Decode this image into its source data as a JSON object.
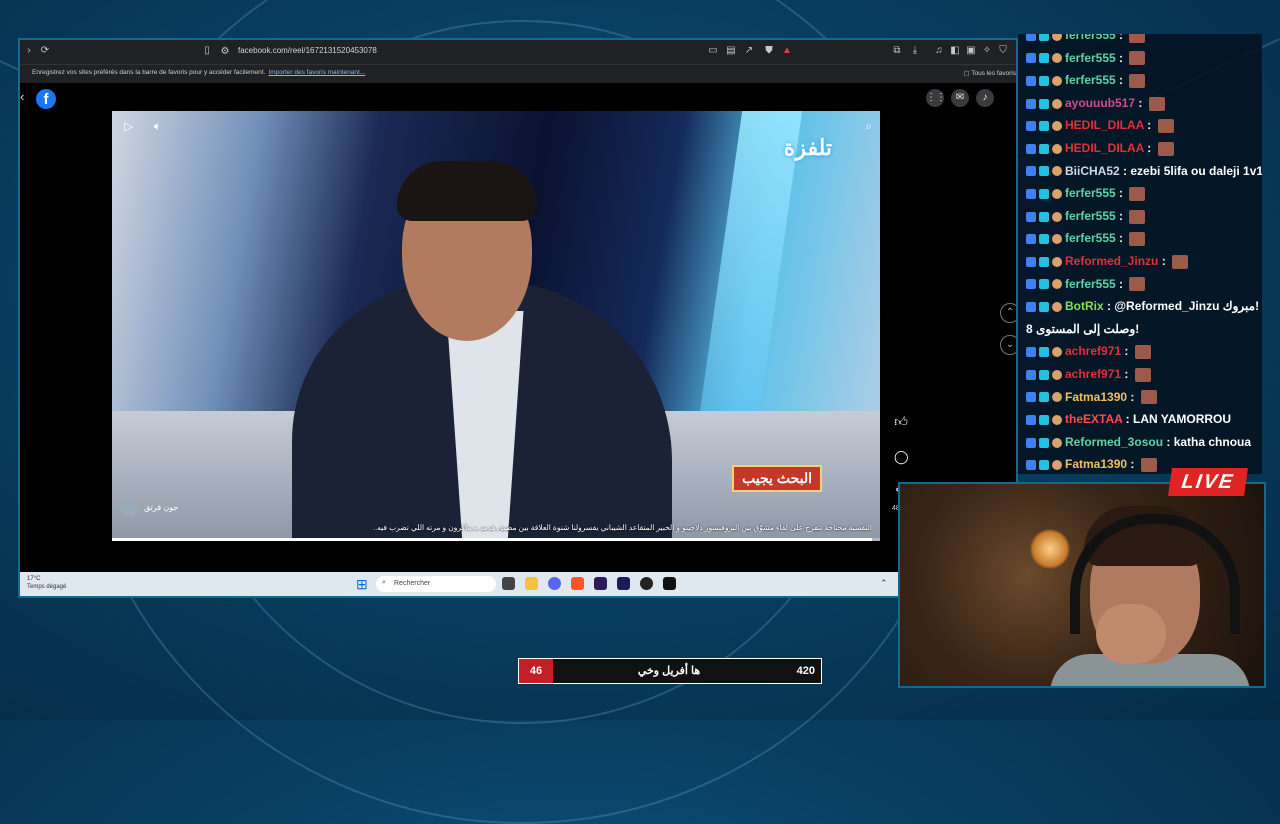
{
  "browser": {
    "url": "facebook.com/reel/1672131520453078",
    "bookmark_hint": "Enregistrez vos sites préférés dans la barre de favoris pour y accéder facilement.",
    "bookmark_link": "Importer des favoris maintenant...",
    "all_favorites": "Tous les favoris"
  },
  "facebook": {
    "logo": "f",
    "video": {
      "channel_logo": "تلفزة",
      "program_badge": "البحث يجيب",
      "page_name": "جون فرتق",
      "caption": "النفسية محتاجة تتفرج على لقاء مشوّق بين البروفيسور دلاجينو و الخبير المتقاعد الشيباني يفسرولنا شنوة العلاقة بين مضيق هرمز و ماكرون و مرته اللي تضرب فيه..",
      "progress": 0.99
    },
    "comment_count": "48"
  },
  "taskbar": {
    "weather_temp": "17°C",
    "weather_desc": "Temps dégagé",
    "search_placeholder": "Rechercher"
  },
  "chat": {
    "messages": [
      {
        "user": "ferfer555",
        "text": "",
        "color": "#5fd3a5",
        "emote": true
      },
      {
        "user": "ferfer555",
        "text": "",
        "color": "#5fd3a5",
        "emote": true
      },
      {
        "user": "ferfer555",
        "text": "",
        "color": "#5fd3a5",
        "emote": true
      },
      {
        "user": "ayouuub517",
        "text": "",
        "color": "#d14a8b",
        "emote": true
      },
      {
        "user": "HEDIL_DILAA",
        "text": "",
        "color": "#e0303a",
        "emote": true
      },
      {
        "user": "HEDIL_DILAA",
        "text": "",
        "color": "#e0303a",
        "emote": true
      },
      {
        "user": "BiiCHA52",
        "text": "ezebi 5lifa ou daleji 1v1",
        "color": "#cfd8e6",
        "emote": false
      },
      {
        "user": "ferfer555",
        "text": "",
        "color": "#5fd3a5",
        "emote": true
      },
      {
        "user": "ferfer555",
        "text": "",
        "color": "#5fd3a5",
        "emote": true
      },
      {
        "user": "ferfer555",
        "text": "",
        "color": "#5fd3a5",
        "emote": true
      },
      {
        "user": "Reformed_Jinzu",
        "text": "",
        "color": "#e0303a",
        "emote": true
      },
      {
        "user": "ferfer555",
        "text": "",
        "color": "#5fd3a5",
        "emote": true
      },
      {
        "user": "BotRix",
        "text": "@Reformed_Jinzu مبروك!",
        "color": "#7fe05a",
        "emote": false
      },
      {
        "user": "",
        "text": "وصلت إلى المستوى 8!",
        "color": "#ffffff",
        "emote": false
      },
      {
        "user": "achref971",
        "text": "",
        "color": "#e0303a",
        "emote": true
      },
      {
        "user": "achref971",
        "text": "",
        "color": "#e0303a",
        "emote": true
      },
      {
        "user": "Fatma1390",
        "text": "",
        "color": "#f0c060",
        "emote": true
      },
      {
        "user": "theEXTAA",
        "text": "LAN YAMORROU",
        "color": "#ff4b4b",
        "emote": false
      },
      {
        "user": "Reformed_3osou",
        "text": "katha chnoua",
        "color": "#5fd3a5",
        "emote": false
      },
      {
        "user": "Fatma1390",
        "text": "",
        "color": "#f0c060",
        "emote": true
      }
    ]
  },
  "overlay": {
    "live_label": "LIVE",
    "poll_left": "46",
    "poll_title": "ها أفريل وخي",
    "poll_right": "420"
  }
}
